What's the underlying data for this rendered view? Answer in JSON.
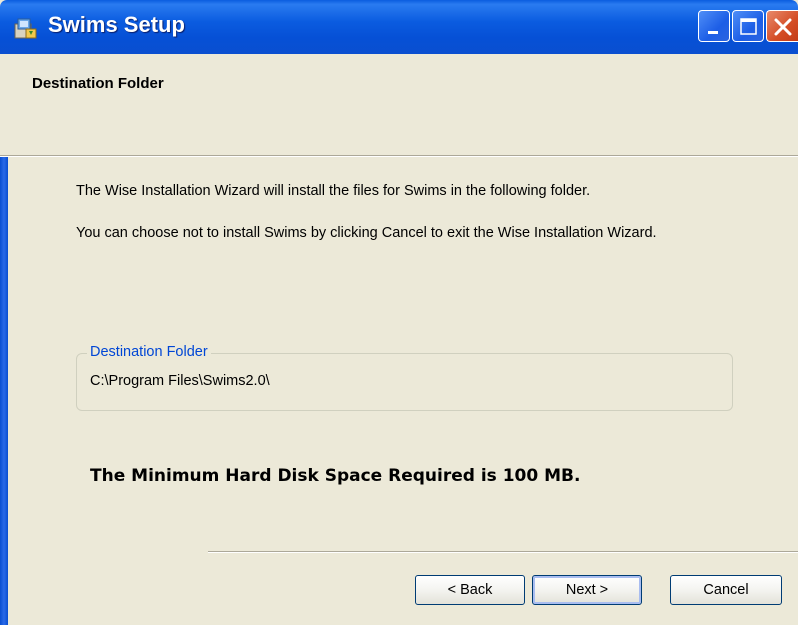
{
  "window": {
    "title": "Swims Setup"
  },
  "header": {
    "title": "Destination Folder"
  },
  "body": {
    "line1": "The Wise Installation Wizard will install the files for Swims in the following folder.",
    "line2": "You can choose not to install Swims by clicking Cancel to exit the Wise Installation Wizard."
  },
  "destination": {
    "legend": "Destination Folder",
    "path": "C:\\Program Files\\Swims2.0\\"
  },
  "disk_space_text": "The Minimum Hard Disk Space Required is 100 MB.",
  "buttons": {
    "back": "< Back",
    "next": "Next >",
    "cancel": "Cancel"
  },
  "icons": {
    "app": "installer-icon",
    "minimize": "minimize-icon",
    "maximize": "maximize-icon",
    "close": "close-icon"
  },
  "colors": {
    "titlebar": "#0a5ddf",
    "legend_text": "#0046d5",
    "dialog_bg": "#ece9d8",
    "close_button": "#d44d25"
  }
}
